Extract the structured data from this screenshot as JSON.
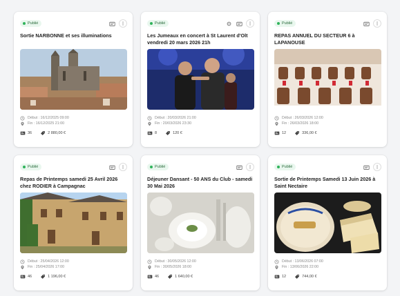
{
  "colors": {
    "accent": "#2fb35a",
    "badge_bg": "#e9f7ee",
    "card_bg": "#ffffff",
    "page_bg": "#f3f4f6"
  },
  "cards": [
    {
      "badge": "Publié",
      "title": "Sortie NARBONNE et ses illuminations",
      "start": "Début : 16/12/2025 09:00",
      "end": "Fin : 16/12/2025 21:00",
      "participants": "36",
      "amount": "2 880,00 €",
      "image": "cathedral-town",
      "has_edit_icon": false
    },
    {
      "badge": "Publié",
      "title": "Les Jumeaux en concert à St Laurent d'Olt vendredi 20 mars 2026 21h",
      "start": "Début : 20/03/2026 21:00",
      "end": "Fin : 20/03/2026 23:30",
      "participants": "8",
      "amount": "120 €",
      "image": "concert-singers",
      "has_edit_icon": true
    },
    {
      "badge": "Publié",
      "title": "REPAS ANNUEL DU SECTEUR 6 à LAPANOUSE",
      "start": "Début : 26/03/2026 12:00",
      "end": "Fin : 26/03/2026 18:00",
      "participants": "12",
      "amount": "336,00 €",
      "image": "banquet-hall",
      "has_edit_icon": false
    },
    {
      "badge": "Publié",
      "title": "Repas de Printemps samedi 25 Avril 2026 chez RODIER à Campagnac",
      "start": "Début : 25/04/2026 12:00",
      "end": "Fin : 25/04/2026 17:00",
      "participants": "46",
      "amount": "1 196,00 €",
      "image": "stone-manor",
      "has_edit_icon": false
    },
    {
      "badge": "Publié",
      "title": "Déjeuner Dansant - 50 ANS du Club - samedi 30 Mai 2026",
      "start": "Début : 30/05/2026 12:00",
      "end": "Fin : 30/05/2026 18:00",
      "participants": "46",
      "amount": "1 640,00 €",
      "image": "table-setting",
      "has_edit_icon": false
    },
    {
      "badge": "Publié",
      "title": "Sortie de Printemps Samedi 13 Juin 2026 à Saint Nectaire",
      "start": "Début : 13/06/2026 07:00",
      "end": "Fin : 13/06/2026 22:00",
      "participants": "12",
      "amount": "744,00 €",
      "image": "cheese-wheels",
      "has_edit_icon": false
    }
  ]
}
